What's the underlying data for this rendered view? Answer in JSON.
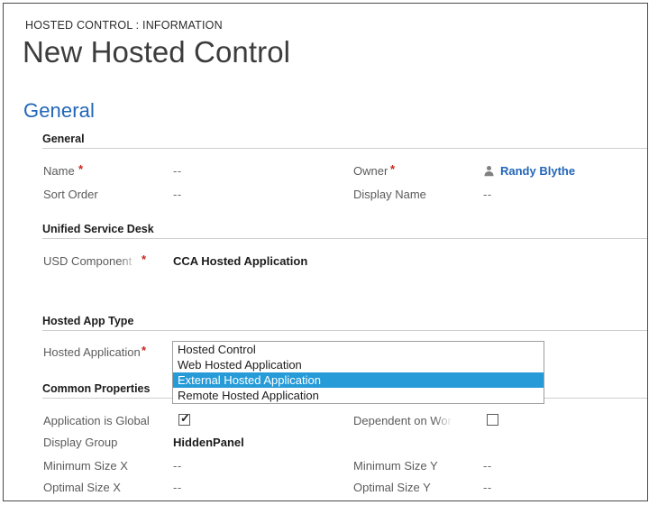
{
  "header": {
    "breadcrumb": "HOSTED CONTROL : INFORMATION",
    "title": "New Hosted Control",
    "tab": "General"
  },
  "colors": {
    "accent_blue": "#2266b8",
    "highlight_blue": "#269bd8",
    "required_red": "#c9261d",
    "label_gray": "#5b5b5b",
    "rule_gray": "#cfcfcf"
  },
  "sections": {
    "general": {
      "label": "General",
      "fields": [
        {
          "label": "Name",
          "required": "*",
          "value": "--"
        },
        {
          "label": "Owner",
          "required": "*",
          "value": "Randy Blythe",
          "icon": "person-icon"
        },
        {
          "label": "Sort Order",
          "required": "",
          "value": "--"
        },
        {
          "label": "Display Name",
          "required": "",
          "value": "--"
        }
      ]
    },
    "unified_service_desk": {
      "label": "Unified Service Desk",
      "fields": [
        {
          "label": "USD Component Type",
          "required": "*",
          "value": "CCA Hosted Application"
        }
      ]
    },
    "hosted_app_type": {
      "label": "Hosted App Type",
      "fields": [
        {
          "label": "Hosted Application",
          "required": "*",
          "value": "External Hosted Application"
        }
      ]
    },
    "common_properties": {
      "label": "Common Properties",
      "fields": [
        {
          "label": "Application is Global",
          "required": "",
          "value": "checked"
        },
        {
          "label": "Dependent on Workflow",
          "required": "",
          "value": "unchecked"
        },
        {
          "label": "Display Group",
          "required": "",
          "value": "HiddenPanel"
        },
        {
          "label": "Minimum Size X",
          "required": "",
          "value": "--"
        },
        {
          "label": "Minimum Size Y",
          "required": "",
          "value": "--"
        },
        {
          "label": "Optimal Size X",
          "required": "",
          "value": "--"
        },
        {
          "label": "Optimal Size Y",
          "required": "",
          "value": "--"
        }
      ]
    }
  },
  "dropdown": {
    "options": [
      "Hosted Control",
      "Web Hosted Application",
      "External Hosted Application",
      "Remote Hosted Application"
    ],
    "selected_index": 2
  }
}
